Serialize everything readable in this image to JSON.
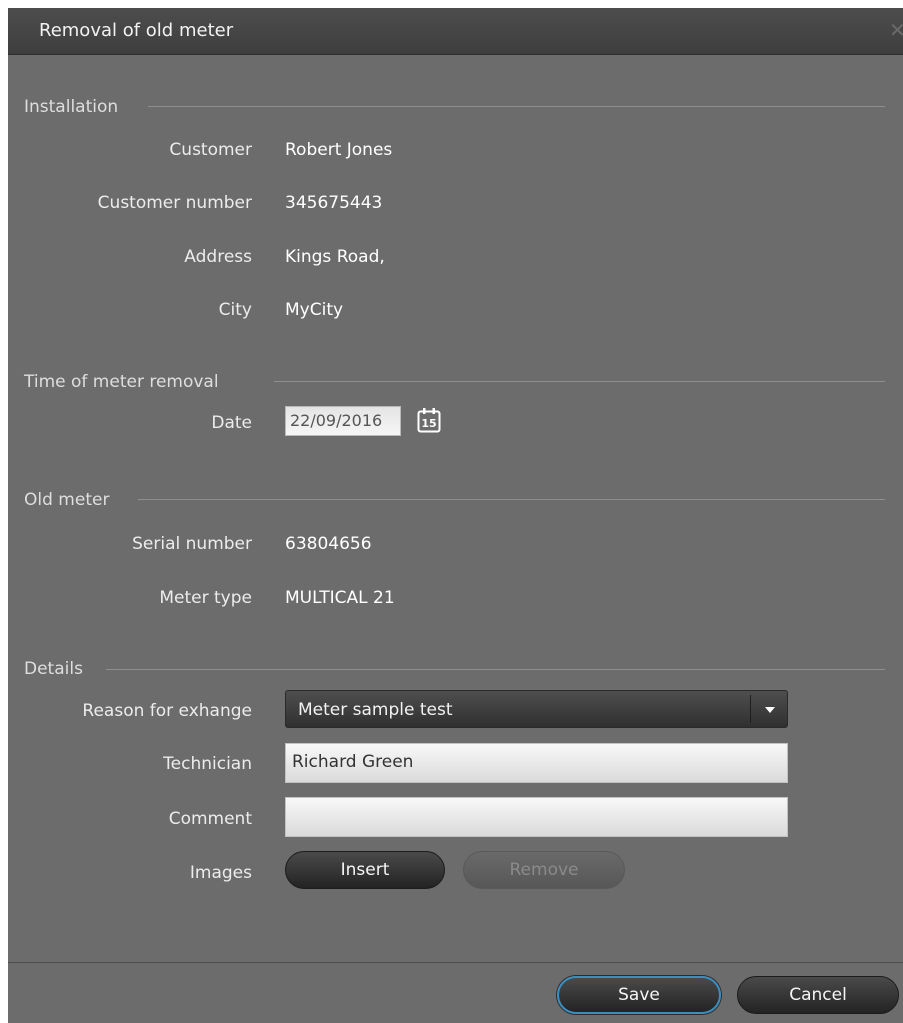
{
  "dialog": {
    "title": "Removal of old meter",
    "close_icon": "close-icon"
  },
  "installation": {
    "section_title": "Installation",
    "fields": [
      {
        "label": "Customer",
        "value": "Robert Jones"
      },
      {
        "label": "Customer number",
        "value": "345675443"
      },
      {
        "label": "Address",
        "value": "Kings Road,"
      },
      {
        "label": "City",
        "value": "MyCity"
      }
    ]
  },
  "removal_time": {
    "section_title": "Time of meter removal",
    "date_label": "Date",
    "date_value": "22/09/2016",
    "calendar_icon": "calendar-icon",
    "calendar_day": "15"
  },
  "old_meter": {
    "section_title": "Old meter",
    "fields": [
      {
        "label": "Serial number",
        "value": "63804656"
      },
      {
        "label": "Meter type",
        "value": "MULTICAL 21"
      }
    ]
  },
  "details": {
    "section_title": "Details",
    "reason_label": "Reason for exhange",
    "reason_value": "Meter sample test",
    "technician_label": "Technician",
    "technician_value": "Richard Green",
    "comment_label": "Comment",
    "comment_value": "",
    "images_label": "Images",
    "insert_label": "Insert",
    "remove_label": "Remove"
  },
  "footer": {
    "save_label": "Save",
    "cancel_label": "Cancel"
  },
  "colors": {
    "background": "#6c6c6c",
    "titlebar": "#444444",
    "focus_ring": "#3a8fc2"
  }
}
